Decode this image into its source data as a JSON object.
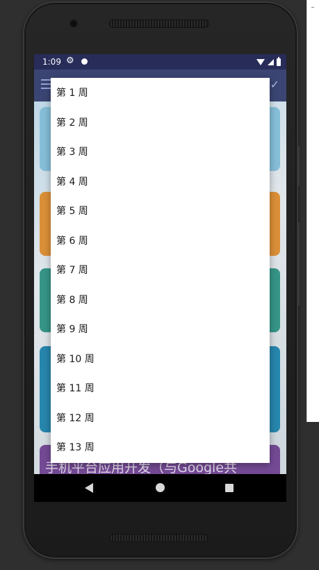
{
  "status_bar": {
    "time": "1:09"
  },
  "app_bar": {
    "menu_icon": "hamburger-menu-icon",
    "right_icon": "chevron-down-icon"
  },
  "cards": [
    {
      "text": ""
    },
    {
      "text": ""
    },
    {
      "text": ""
    },
    {
      "text": ""
    },
    {
      "text": "手机平台应用开发（与Google共"
    }
  ],
  "week_menu": {
    "items": [
      "第 1 周",
      "第 2 周",
      "第 3 周",
      "第 4 周",
      "第 5 周",
      "第 6 周",
      "第 7 周",
      "第 8 周",
      "第 9 周",
      "第 10 周",
      "第 11 周",
      "第 12 周",
      "第 13 周"
    ]
  },
  "colors": {
    "status_bar": "#1a1f4f",
    "app_bar": "#2f3a6b",
    "card_blue": "#7fbad6",
    "card_orange": "#d9892c",
    "card_teal": "#2a8f80",
    "card_deep_blue": "#1a7fa8",
    "card_purple": "#6c3f8f",
    "popup_bg": "#ffffff"
  }
}
